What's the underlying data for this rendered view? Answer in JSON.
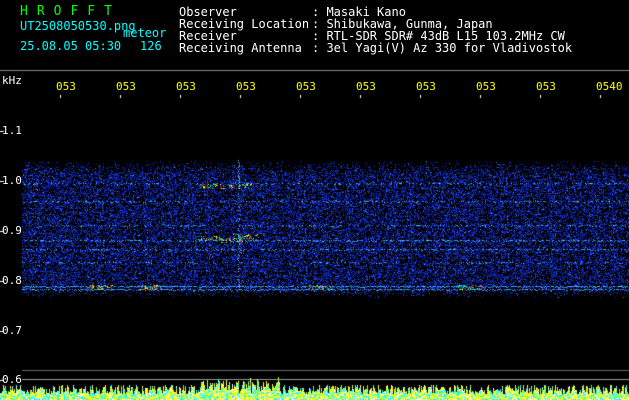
{
  "header": {
    "brand": "HROFFT",
    "filename": "UT2508050530.png",
    "meteor_label": "meteor",
    "datetime": "25.08.05 05:30",
    "count": "126",
    "fields": [
      {
        "label": "Observer",
        "value": ": Masaki Kano"
      },
      {
        "label": "Receiving Location",
        "value": ": Shibukawa, Gunma, Japan"
      },
      {
        "label": "Receiver",
        "value": ": RTL-SDR SDR# 43dB L15 103.2MHz CW"
      },
      {
        "label": "Receiving Antenna",
        "value": ": 3el Yagi(V) Az 330 for Vladivostok"
      }
    ]
  },
  "axis": {
    "unit": "kHz",
    "y_ticks": [
      "1.1",
      "1.0",
      "0.9",
      "0.8",
      "0.7",
      "0.6"
    ],
    "x_ticks": [
      "053",
      "053",
      "053",
      "053",
      "053",
      "053",
      "053",
      "053",
      "053",
      "0540"
    ]
  },
  "colors": {
    "header_text": "#ffffff",
    "brand": "#00ff00",
    "time_labels": "#ffff00",
    "noise": "#1a3cff",
    "signal_hot": "#ff3030",
    "signal_warm": "#ffff00",
    "signal_cool": "#00ffff",
    "background": "#000000"
  }
}
